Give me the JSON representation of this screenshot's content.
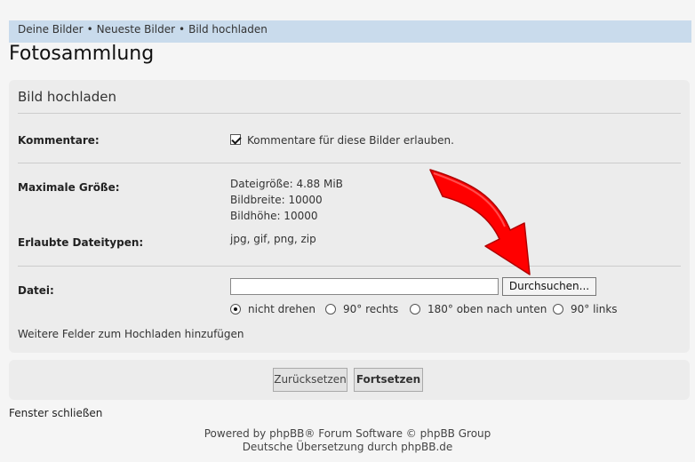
{
  "breadcrumb": {
    "items": [
      "Deine Bilder",
      "Neueste Bilder",
      "Bild hochladen"
    ],
    "separator": "•"
  },
  "page": {
    "title": "Fotosammlung"
  },
  "panel": {
    "title": "Bild hochladen",
    "comments": {
      "label": "Kommentare:",
      "checkbox_label": "Kommentare für diese Bilder erlauben.",
      "checked": true
    },
    "max_size": {
      "label": "Maximale Größe:",
      "lines": [
        "Dateigröße: 4.88 MiB",
        "Bildbreite: 10000",
        "Bildhöhe: 10000"
      ]
    },
    "types": {
      "label": "Erlaubte Dateitypen:",
      "value": "jpg, gif, png, zip"
    },
    "file": {
      "label": "Datei:",
      "value": "",
      "browse_label": "Durchsuchen..."
    },
    "rotate_options": [
      {
        "label": "nicht drehen",
        "selected": true
      },
      {
        "label": "90° rechts",
        "selected": false
      },
      {
        "label": "180° oben nach unten",
        "selected": false
      },
      {
        "label": "90° links",
        "selected": false
      }
    ],
    "more_fields": "Weitere Felder zum Hochladen hinzufügen"
  },
  "buttons": {
    "reset": "Zurücksetzen",
    "submit": "Fortsetzen"
  },
  "close_window": "Fenster schließen",
  "footer": {
    "line1": "Powered by phpBB® Forum Software © phpBB Group",
    "line2": "Deutsche Übersetzung durch phpBB.de"
  },
  "colors": {
    "breadcrumb_bg": "#c9dbec",
    "panel_bg": "#ececec",
    "arrow": "#ff0000"
  },
  "annotation_icon": "red-curved-arrow-icon"
}
